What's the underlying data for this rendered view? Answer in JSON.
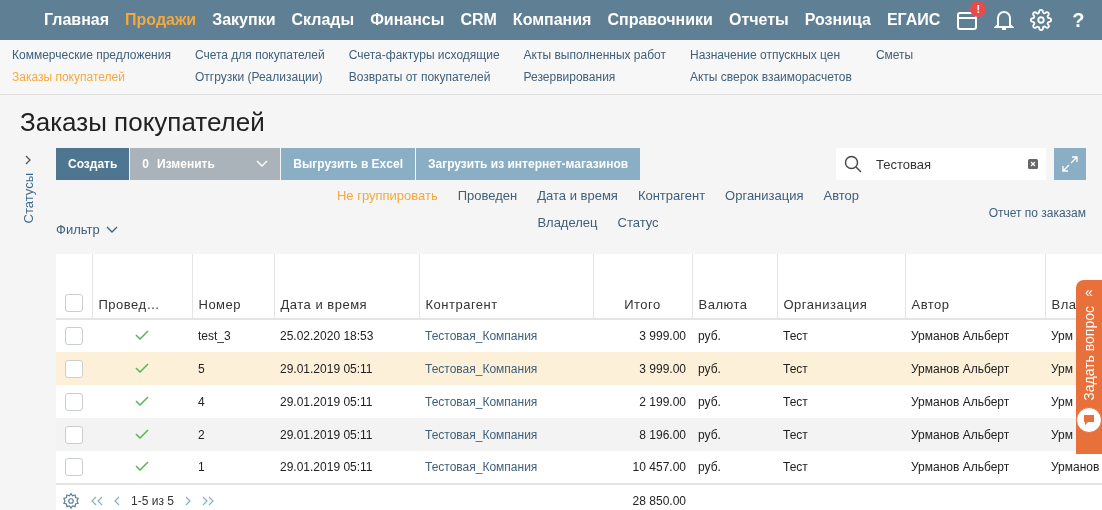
{
  "nav": {
    "items": [
      {
        "label": "Главная",
        "selected": false
      },
      {
        "label": "Продажи",
        "selected": true
      },
      {
        "label": "Закупки",
        "selected": false
      },
      {
        "label": "Склады",
        "selected": false
      },
      {
        "label": "Финансы",
        "selected": false
      },
      {
        "label": "CRM",
        "selected": false
      },
      {
        "label": "Компания",
        "selected": false
      },
      {
        "label": "Справочники",
        "selected": false
      },
      {
        "label": "Отчеты",
        "selected": false
      },
      {
        "label": "Розница",
        "selected": false
      },
      {
        "label": "ЕГАИС",
        "selected": false
      }
    ],
    "calendar_badge": "!",
    "help": "?"
  },
  "submenu": {
    "columns": [
      [
        {
          "label": "Коммерческие предложения",
          "selected": false
        },
        {
          "label": "Заказы покупателей",
          "selected": true
        }
      ],
      [
        {
          "label": "Счета для покупателей",
          "selected": false
        },
        {
          "label": "Отгрузки (Реализации)",
          "selected": false
        }
      ],
      [
        {
          "label": "Счета-фактуры исходящие",
          "selected": false
        },
        {
          "label": "Возвраты от покупателей",
          "selected": false
        }
      ],
      [
        {
          "label": "Акты выполненных работ",
          "selected": false
        },
        {
          "label": "Резервирования",
          "selected": false
        }
      ],
      [
        {
          "label": "Назначение отпускных цен",
          "selected": false
        },
        {
          "label": "Акты сверок взаиморасчетов",
          "selected": false
        }
      ],
      [
        {
          "label": "Сметы",
          "selected": false
        }
      ]
    ]
  },
  "title": "Заказы покупателей",
  "sidebar": {
    "label": "Статусы"
  },
  "toolbar": {
    "buttons": [
      {
        "kind": "primary",
        "label": "Создать",
        "disabled": false
      },
      {
        "kind": "dropdown",
        "count": "0",
        "label": "Изменить",
        "disabled": true
      },
      {
        "kind": "secondary",
        "label": "Выгрузить в Excel",
        "disabled": false
      },
      {
        "kind": "secondary",
        "label": "Загрузить из интернет-магазинов",
        "disabled": false
      }
    ],
    "search": {
      "value": "Тестовая"
    }
  },
  "grouping": {
    "options": [
      {
        "label": "Не группировать",
        "selected": true
      },
      {
        "label": "Проведен",
        "selected": false
      },
      {
        "label": "Дата и время",
        "selected": false
      },
      {
        "label": "Контрагент",
        "selected": false
      },
      {
        "label": "Организация",
        "selected": false
      },
      {
        "label": "Автор",
        "selected": false
      },
      {
        "label": "Владелец",
        "selected": false
      },
      {
        "label": "Статус",
        "selected": false
      }
    ]
  },
  "filter": {
    "label": "Фильтр"
  },
  "report_link": "Отчет по заказам",
  "table": {
    "all_checked": false,
    "columns": [
      "Провед…",
      "Номер",
      "Дата и время",
      "Контрагент",
      "Итого",
      "Валюта",
      "Организация",
      "Автор",
      "Вла"
    ],
    "rows": [
      {
        "checked": false,
        "posted": true,
        "number": "test_3",
        "date": "25.02.2020 18:53",
        "counterparty": "Тестовая_Компания",
        "total": "3 999.00",
        "currency": "руб.",
        "organization": "Тест",
        "author": "Урманов Альберт",
        "owner": "Урм",
        "selected": false
      },
      {
        "checked": false,
        "posted": true,
        "number": "5",
        "date": "29.01.2019 05:11",
        "counterparty": "Тестовая_Компания",
        "total": "3 999.00",
        "currency": "руб.",
        "organization": "Тест",
        "author": "Урманов Альберт",
        "owner": "Урм",
        "selected": true
      },
      {
        "checked": false,
        "posted": true,
        "number": "4",
        "date": "29.01.2019 05:11",
        "counterparty": "Тестовая_Компания",
        "total": "2 199.00",
        "currency": "руб.",
        "organization": "Тест",
        "author": "Урманов Альберт",
        "owner": "Урм",
        "selected": false
      },
      {
        "checked": false,
        "posted": true,
        "number": "2",
        "date": "29.01.2019 05:11",
        "counterparty": "Тестовая_Компания",
        "total": "8 196.00",
        "currency": "руб.",
        "organization": "Тест",
        "author": "Урманов Альберт",
        "owner": "Урм",
        "selected": false
      },
      {
        "checked": false,
        "posted": true,
        "number": "1",
        "date": "29.01.2019 05:11",
        "counterparty": "Тестовая_Компания",
        "total": "10 457.00",
        "currency": "руб.",
        "organization": "Тест",
        "author": "Урманов Альберт",
        "owner": "Урманов",
        "selected": false
      }
    ],
    "footer": {
      "pager": "1-5 из 5",
      "total": "28 850.00"
    }
  },
  "help_tab": {
    "collapse": "«",
    "label": "Задать вопрос"
  }
}
